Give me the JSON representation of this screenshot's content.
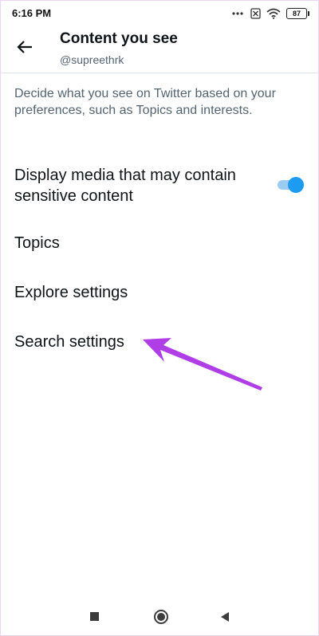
{
  "status_bar": {
    "time": "6:16 PM",
    "battery": "87",
    "icons": [
      "signal-dots-icon",
      "no-sim-icon",
      "wifi-icon",
      "battery-icon"
    ]
  },
  "header": {
    "back_icon": "arrow-left-icon",
    "title": "Content you see",
    "subtitle": "@supreethrk"
  },
  "description": "Decide what you see on Twitter based on your preferences, such as Topics and interests.",
  "settings": {
    "sensitive_media": {
      "label": "Display media that may contain sensitive content",
      "enabled": true
    },
    "topics": {
      "label": "Topics"
    },
    "explore": {
      "label": "Explore settings"
    },
    "search": {
      "label": "Search settings"
    }
  },
  "annotation": {
    "color": "#b03ee6",
    "icon": "pointer-arrow-icon"
  },
  "nav_bar": {
    "icons": [
      "recents-square-icon",
      "home-circle-icon",
      "back-triangle-icon"
    ]
  },
  "colors": {
    "accent": "#1d9bf0",
    "toggle_track": "#9bcdf3",
    "primary_text": "#0f1419",
    "secondary_text": "#536471"
  }
}
